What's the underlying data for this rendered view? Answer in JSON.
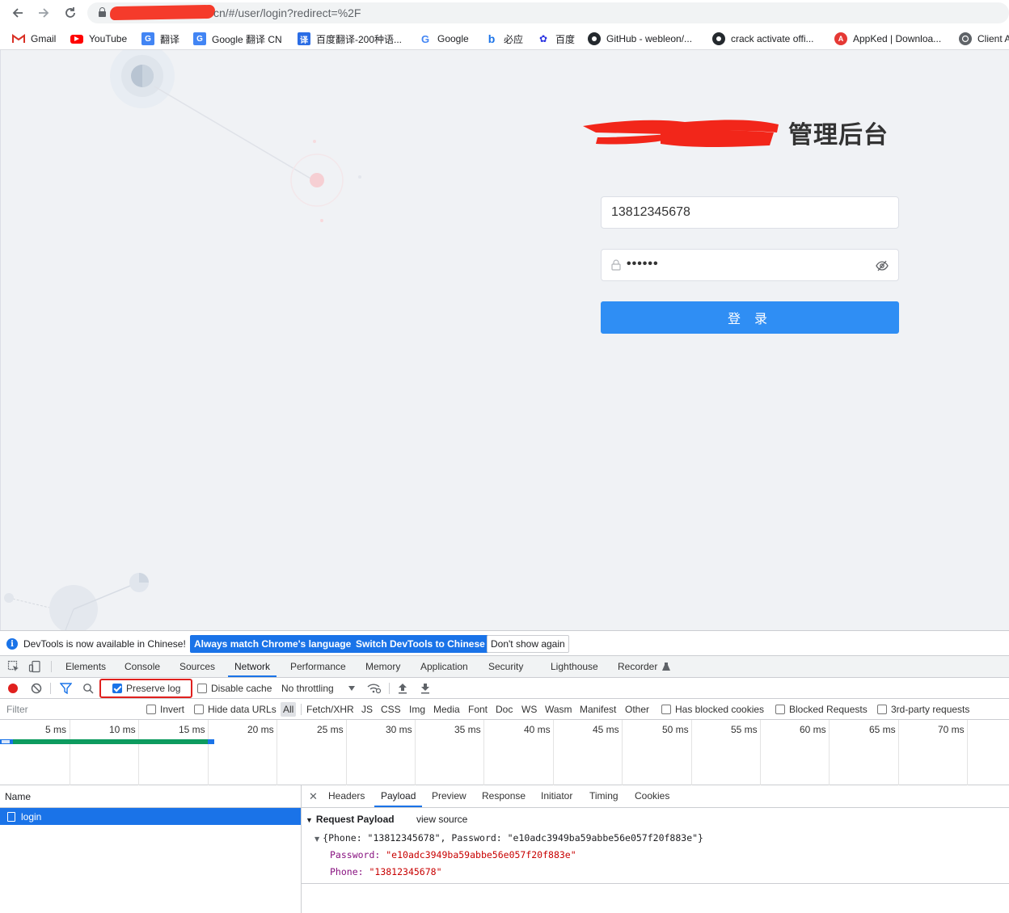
{
  "browser": {
    "url_visible": "cn/#/user/login?redirect=%2F",
    "bookmarks": [
      {
        "label": "Gmail",
        "icon": "gmail-icon"
      },
      {
        "label": "YouTube",
        "icon": "youtube-icon"
      },
      {
        "label": "翻译",
        "icon": "translate-icon"
      },
      {
        "label": "Google 翻译 CN",
        "icon": "translate-icon"
      },
      {
        "label": "百度翻译-200种语...",
        "icon": "baidu-translate-icon"
      },
      {
        "label": "Google",
        "icon": "google-icon"
      },
      {
        "label": "必应",
        "icon": "bing-icon"
      },
      {
        "label": "百度",
        "icon": "baidu-icon"
      },
      {
        "label": "GitHub - webleon/...",
        "icon": "github-icon"
      },
      {
        "label": "crack activate offi...",
        "icon": "github-icon"
      },
      {
        "label": "AppKed | Downloa...",
        "icon": "appked-icon"
      },
      {
        "label": "Client A",
        "icon": "globe-icon"
      }
    ]
  },
  "login": {
    "title": "管理后台",
    "phone_value": "13812345678",
    "password_mask": "••••••",
    "submit_label": "登 录"
  },
  "devtools": {
    "info_text": "DevTools is now available in Chinese!",
    "btn_always_match": "Always match Chrome's language",
    "btn_switch": "Switch DevTools to Chinese",
    "btn_dont_show": "Don't show again",
    "tabs": [
      "Elements",
      "Console",
      "Sources",
      "Network",
      "Performance",
      "Memory",
      "Application",
      "Security",
      "Lighthouse",
      "Recorder"
    ],
    "active_tab": "Network",
    "toolbar": {
      "preserve_log": "Preserve log",
      "disable_cache": "Disable cache",
      "throttling": "No throttling"
    },
    "filter": {
      "placeholder": "Filter",
      "invert": "Invert",
      "hide_data_urls": "Hide data URLs",
      "types": [
        "All",
        "Fetch/XHR",
        "JS",
        "CSS",
        "Img",
        "Media",
        "Font",
        "Doc",
        "WS",
        "Wasm",
        "Manifest",
        "Other"
      ],
      "has_blocked": "Has blocked cookies",
      "blocked_requests": "Blocked Requests",
      "third_party": "3rd-party requests"
    },
    "timeline_ticks": [
      "5 ms",
      "10 ms",
      "15 ms",
      "20 ms",
      "25 ms",
      "30 ms",
      "35 ms",
      "40 ms",
      "45 ms",
      "50 ms",
      "55 ms",
      "60 ms",
      "65 ms",
      "70 ms"
    ],
    "name_header": "Name",
    "request_name": "login",
    "detail_tabs": [
      "Headers",
      "Payload",
      "Preview",
      "Response",
      "Initiator",
      "Timing",
      "Cookies"
    ],
    "active_detail_tab": "Payload",
    "payload": {
      "heading": "Request Payload",
      "view_source": "view source",
      "object_summary": "{Phone: \"13812345678\", Password: \"e10adc3949ba59abbe56e057f20f883e\"}",
      "password_key": "Password",
      "password_value": "\"e10adc3949ba59abbe56e057f20f883e\"",
      "phone_key": "Phone",
      "phone_value": "\"13812345678\""
    }
  }
}
